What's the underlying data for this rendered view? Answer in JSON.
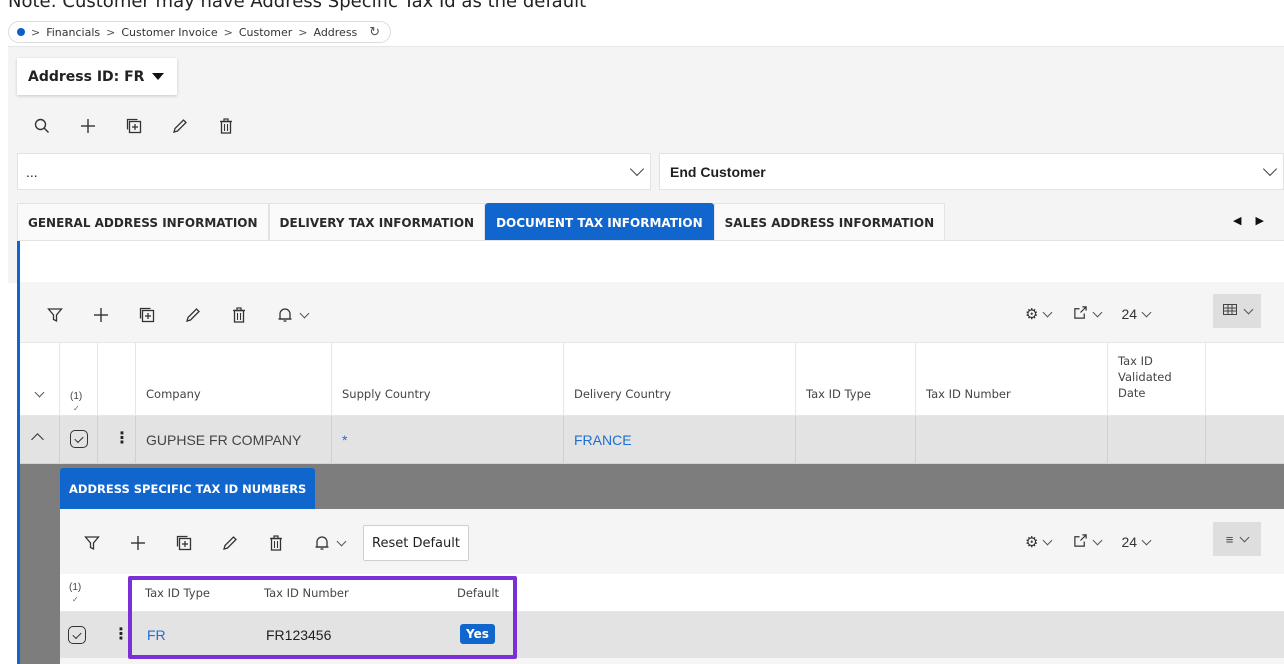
{
  "caption": "Note: Customer may have Address Specific Tax Id as the default",
  "breadcrumb": [
    "Financials",
    "Customer Invoice",
    "Customer",
    "Address"
  ],
  "address_selector": {
    "label": "Address ID: FR"
  },
  "selector_left": {
    "value": "..."
  },
  "selector_right": {
    "value": "End Customer"
  },
  "tabs": [
    {
      "label": "GENERAL ADDRESS INFORMATION",
      "active": false
    },
    {
      "label": "DELIVERY TAX INFORMATION",
      "active": false
    },
    {
      "label": "DOCUMENT TAX INFORMATION",
      "active": true
    },
    {
      "label": "SALES ADDRESS INFORMATION",
      "active": false
    }
  ],
  "grid": {
    "page_size": "24",
    "selected_count": "(1)",
    "columns": [
      "Company",
      "Supply Country",
      "Delivery Country",
      "Tax ID Type",
      "Tax ID Number",
      "Tax ID Validated Date"
    ],
    "row": {
      "company": "GUPHSE FR COMPANY",
      "supply_country": "*",
      "delivery_country": "FRANCE",
      "tax_id_type": "",
      "tax_id_number": "",
      "validated_date": ""
    }
  },
  "subgrid": {
    "tab_label": "ADDRESS SPECIFIC TAX ID NUMBERS",
    "reset_label": "Reset Default",
    "page_size": "24",
    "selected_count": "(1)",
    "columns": [
      "Tax ID Type",
      "Tax ID Number",
      "Default"
    ],
    "row": {
      "tax_id_type": "FR",
      "tax_id_number": "FR123456",
      "default": "Yes"
    }
  },
  "colors": {
    "accent": "#1066cc",
    "highlight": "#7b2fd6",
    "link": "#1f6fd1"
  }
}
